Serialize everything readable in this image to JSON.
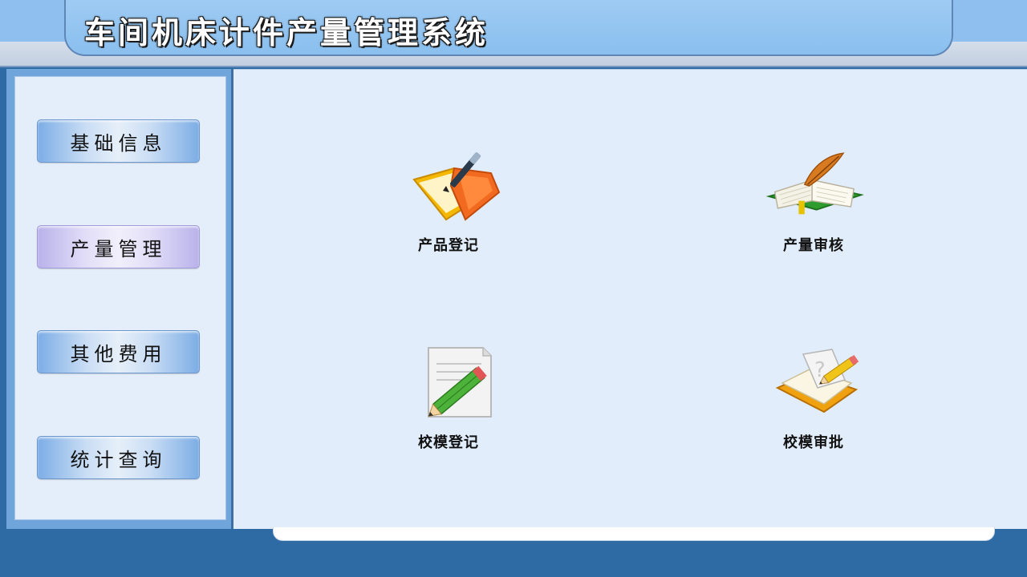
{
  "app": {
    "title": "车间机床计件产量管理系统"
  },
  "sidebar": {
    "items": [
      {
        "label": "基础信息",
        "active": false
      },
      {
        "label": "产量管理",
        "active": true
      },
      {
        "label": "其他费用",
        "active": false
      },
      {
        "label": "统计查询",
        "active": false
      }
    ]
  },
  "main": {
    "tiles": [
      {
        "label": "产品登记",
        "icon": "folder-pen-icon"
      },
      {
        "label": "产量审核",
        "icon": "book-quill-icon"
      },
      {
        "label": "校模登记",
        "icon": "document-pencil-icon"
      },
      {
        "label": "校模审批",
        "icon": "notebook-pencil-icon"
      }
    ]
  },
  "colors": {
    "header": "#8fbfee",
    "sidebar_frame": "#6fa5db",
    "main_bg": "#e1edfa",
    "frame": "#2e6aa3",
    "active_button": "#e2def8"
  }
}
